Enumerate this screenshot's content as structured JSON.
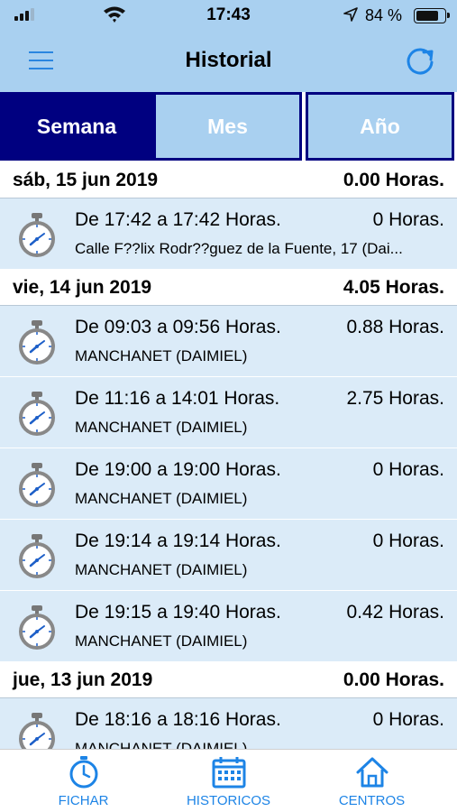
{
  "status_bar": {
    "time": "17:43",
    "battery_percent": "84 %",
    "battery_level": 0.84,
    "icons": [
      "cellular-signal-icon",
      "wifi-icon",
      "location-arrow-icon",
      "battery-icon"
    ]
  },
  "header": {
    "title": "Historial",
    "icons": [
      "menu-icon",
      "refresh-icon"
    ]
  },
  "tabs": [
    {
      "label": "Semana",
      "selected": true
    },
    {
      "label": "Mes",
      "selected": false
    },
    {
      "label": "Año",
      "selected": false
    }
  ],
  "days": [
    {
      "date": "sáb, 15 jun 2019",
      "total": "0.00 Horas.",
      "entries": [
        {
          "range": "De 17:42 a 17:42 Horas.",
          "hours": "0 Horas.",
          "location": "Calle F??lix Rodr??guez de la Fuente, 17 (Dai..."
        }
      ]
    },
    {
      "date": "vie, 14 jun 2019",
      "total": "4.05 Horas.",
      "entries": [
        {
          "range": "De 09:03 a 09:56 Horas.",
          "hours": "0.88 Horas.",
          "location": "MANCHANET (DAIMIEL)"
        },
        {
          "range": "De 11:16 a 14:01 Horas.",
          "hours": "2.75 Horas.",
          "location": "MANCHANET (DAIMIEL)"
        },
        {
          "range": "De 19:00 a 19:00 Horas.",
          "hours": "0 Horas.",
          "location": "MANCHANET (DAIMIEL)"
        },
        {
          "range": "De 19:14 a 19:14 Horas.",
          "hours": "0 Horas.",
          "location": "MANCHANET (DAIMIEL)"
        },
        {
          "range": "De 19:15 a 19:40 Horas.",
          "hours": "0.42 Horas.",
          "location": "MANCHANET (DAIMIEL)"
        }
      ]
    },
    {
      "date": "jue, 13 jun 2019",
      "total": "0.00 Horas.",
      "entries": [
        {
          "range": "De 18:16 a 18:16 Horas.",
          "hours": "0 Horas.",
          "location": "MANCHANET (DAIMIEL)"
        }
      ]
    }
  ],
  "bottom_nav": [
    {
      "label": "FICHAR",
      "icon": "stopwatch-icon"
    },
    {
      "label": "HISTORICOS",
      "icon": "calendar-icon"
    },
    {
      "label": "CENTROS",
      "icon": "home-icon"
    }
  ],
  "colors": {
    "header_bg": "#a9d0f0",
    "tab_selected_bg": "#000080",
    "row_bg": "#dbebf8",
    "accent": "#1d84e6"
  }
}
